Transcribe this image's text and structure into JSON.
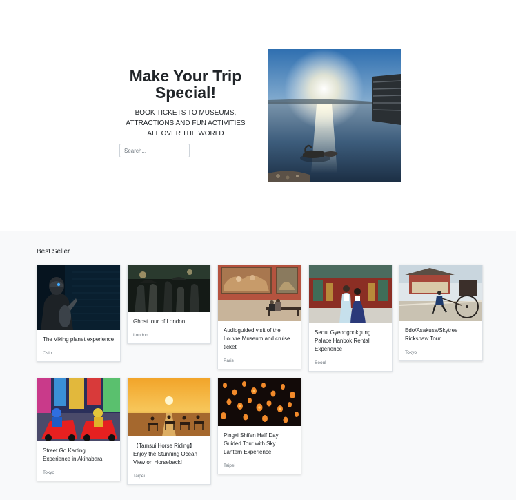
{
  "hero": {
    "title": "Make Your Trip Special!",
    "subtitle": "BOOK TICKETS TO MUSEUMS, ATTRACTIONS AND FUN ACTIVITIES ALL OVER THE WORLD",
    "search_placeholder": "Search..."
  },
  "best_seller": {
    "heading": "Best Seller",
    "cards": [
      {
        "title": "The Viking planet experience",
        "city": "Oslo"
      },
      {
        "title": "Ghost tour of London",
        "city": "London"
      },
      {
        "title": "Audioguided visit of the Louvre Museum and cruise ticket",
        "city": "Paris"
      },
      {
        "title": "Seoul Gyeongbokgung Palace Hanbok Rental Experience",
        "city": "Seoul"
      },
      {
        "title": "Edo/Asakusa/Skytree Rickshaw Tour",
        "city": "Tokyo"
      },
      {
        "title": "Street Go Karting Experience in Akihabara",
        "city": "Tokyo"
      },
      {
        "title": "【Tamsui Horse Riding】Enjoy the Stunning Ocean View on Horseback!",
        "city": "Taipei"
      },
      {
        "title": "Pingxi Shifen Half Day Guided Tour with Sky Lantern Experience",
        "city": "Taipei"
      }
    ]
  }
}
